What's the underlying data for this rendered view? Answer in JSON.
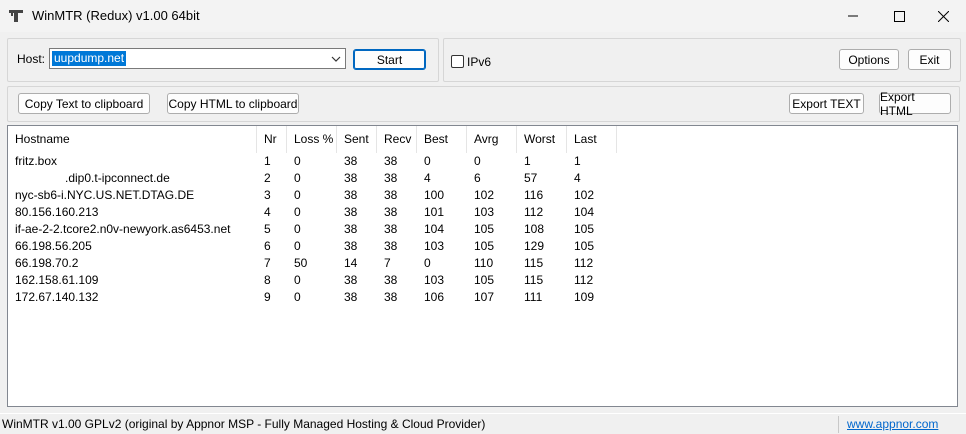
{
  "window": {
    "title": "WinMTR (Redux) v1.00 64bit",
    "icons": {
      "app": "app-icon",
      "minimize": "minimize-icon",
      "maximize": "maximize-icon",
      "close": "close-icon"
    }
  },
  "host": {
    "label": "Host:",
    "value": "uupdump.net",
    "start_label": "Start"
  },
  "ipv6": {
    "label": "IPv6",
    "checked": false
  },
  "buttons": {
    "options": "Options",
    "exit": "Exit",
    "copy_text": "Copy Text to clipboard",
    "copy_html": "Copy HTML to clipboard",
    "export_text": "Export TEXT",
    "export_html": "Export HTML"
  },
  "table": {
    "columns": [
      "Hostname",
      "Nr",
      "Loss %",
      "Sent",
      "Recv",
      "Best",
      "Avrg",
      "Worst",
      "Last"
    ],
    "rows": [
      [
        "fritz.box",
        "1",
        "0",
        "38",
        "38",
        "0",
        "0",
        "1",
        "1"
      ],
      [
        "               .dip0.t-ipconnect.de",
        "2",
        "0",
        "38",
        "38",
        "4",
        "6",
        "57",
        "4"
      ],
      [
        "nyc-sb6-i.NYC.US.NET.DTAG.DE",
        "3",
        "0",
        "38",
        "38",
        "100",
        "102",
        "116",
        "102"
      ],
      [
        "80.156.160.213",
        "4",
        "0",
        "38",
        "38",
        "101",
        "103",
        "112",
        "104"
      ],
      [
        "if-ae-2-2.tcore2.n0v-newyork.as6453.net",
        "5",
        "0",
        "38",
        "38",
        "104",
        "105",
        "108",
        "105"
      ],
      [
        "66.198.56.205",
        "6",
        "0",
        "38",
        "38",
        "103",
        "105",
        "129",
        "105"
      ],
      [
        "66.198.70.2",
        "7",
        "50",
        "14",
        "7",
        "0",
        "110",
        "115",
        "112"
      ],
      [
        "162.158.61.109",
        "8",
        "0",
        "38",
        "38",
        "103",
        "105",
        "115",
        "112"
      ],
      [
        "172.67.140.132",
        "9",
        "0",
        "38",
        "38",
        "106",
        "107",
        "111",
        "109"
      ]
    ]
  },
  "status": {
    "text": "WinMTR v1.00 GPLv2 (original by Appnor MSP - Fully Managed Hosting & Cloud Provider)",
    "link": "www.appnor.com"
  }
}
